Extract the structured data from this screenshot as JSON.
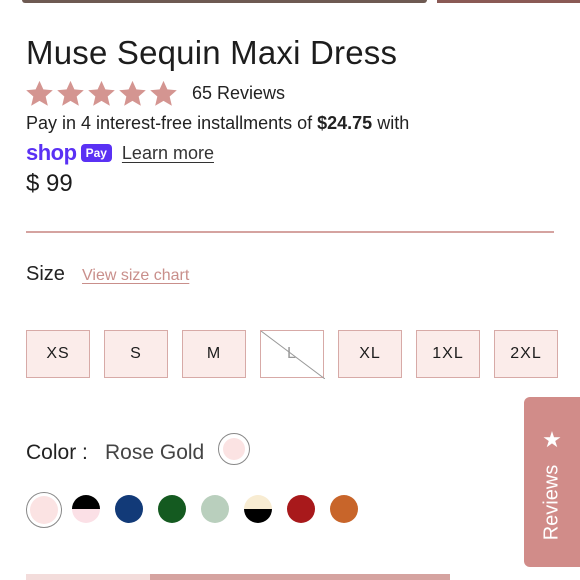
{
  "product": {
    "title": "Muse Sequin Maxi Dress",
    "rating_stars": 5,
    "reviews_label": "65 Reviews",
    "installments_prefix": "Pay in 4 interest-free installments of ",
    "installments_amount": "$24.75",
    "installments_suffix": " with",
    "shoppay_word": "shop",
    "shoppay_badge": "Pay",
    "learn_more": "Learn more",
    "price": "$ 99"
  },
  "size": {
    "label": "Size",
    "chart_link": "View size chart",
    "options": [
      {
        "label": "XS",
        "available": true
      },
      {
        "label": "S",
        "available": true
      },
      {
        "label": "M",
        "available": true
      },
      {
        "label": "L",
        "available": false
      },
      {
        "label": "XL",
        "available": true
      },
      {
        "label": "1XL",
        "available": true
      },
      {
        "label": "2XL",
        "available": true
      }
    ]
  },
  "color": {
    "label": "Color :",
    "selected_name": "Rose Gold",
    "selected_hex": "#fbe3e3",
    "swatches": [
      {
        "name": "rose-gold",
        "top": "#fbe3e3",
        "bottom": "#fbe3e3",
        "selected": true
      },
      {
        "name": "black-pink",
        "top": "#000000",
        "bottom": "#fbe0e6",
        "selected": false
      },
      {
        "name": "navy",
        "top": "#123a78",
        "bottom": "#123a78",
        "selected": false
      },
      {
        "name": "green",
        "top": "#145a20",
        "bottom": "#145a20",
        "selected": false
      },
      {
        "name": "sage",
        "top": "#b9cfbd",
        "bottom": "#b9cfbd",
        "selected": false
      },
      {
        "name": "cream-black",
        "top": "#f8ecd2",
        "bottom": "#000000",
        "selected": false
      },
      {
        "name": "red",
        "top": "#a8191b",
        "bottom": "#a8191b",
        "selected": false
      },
      {
        "name": "orange",
        "top": "#c8652a",
        "bottom": "#c8652a",
        "selected": false
      }
    ]
  },
  "reviews_tab": {
    "label": "Reviews",
    "star": "★"
  },
  "colors": {
    "accent": "#d18c89",
    "star": "#d49591",
    "shoppay": "#5a31f4",
    "size_bg": "#fbecea",
    "size_border": "#d7aaa7"
  }
}
